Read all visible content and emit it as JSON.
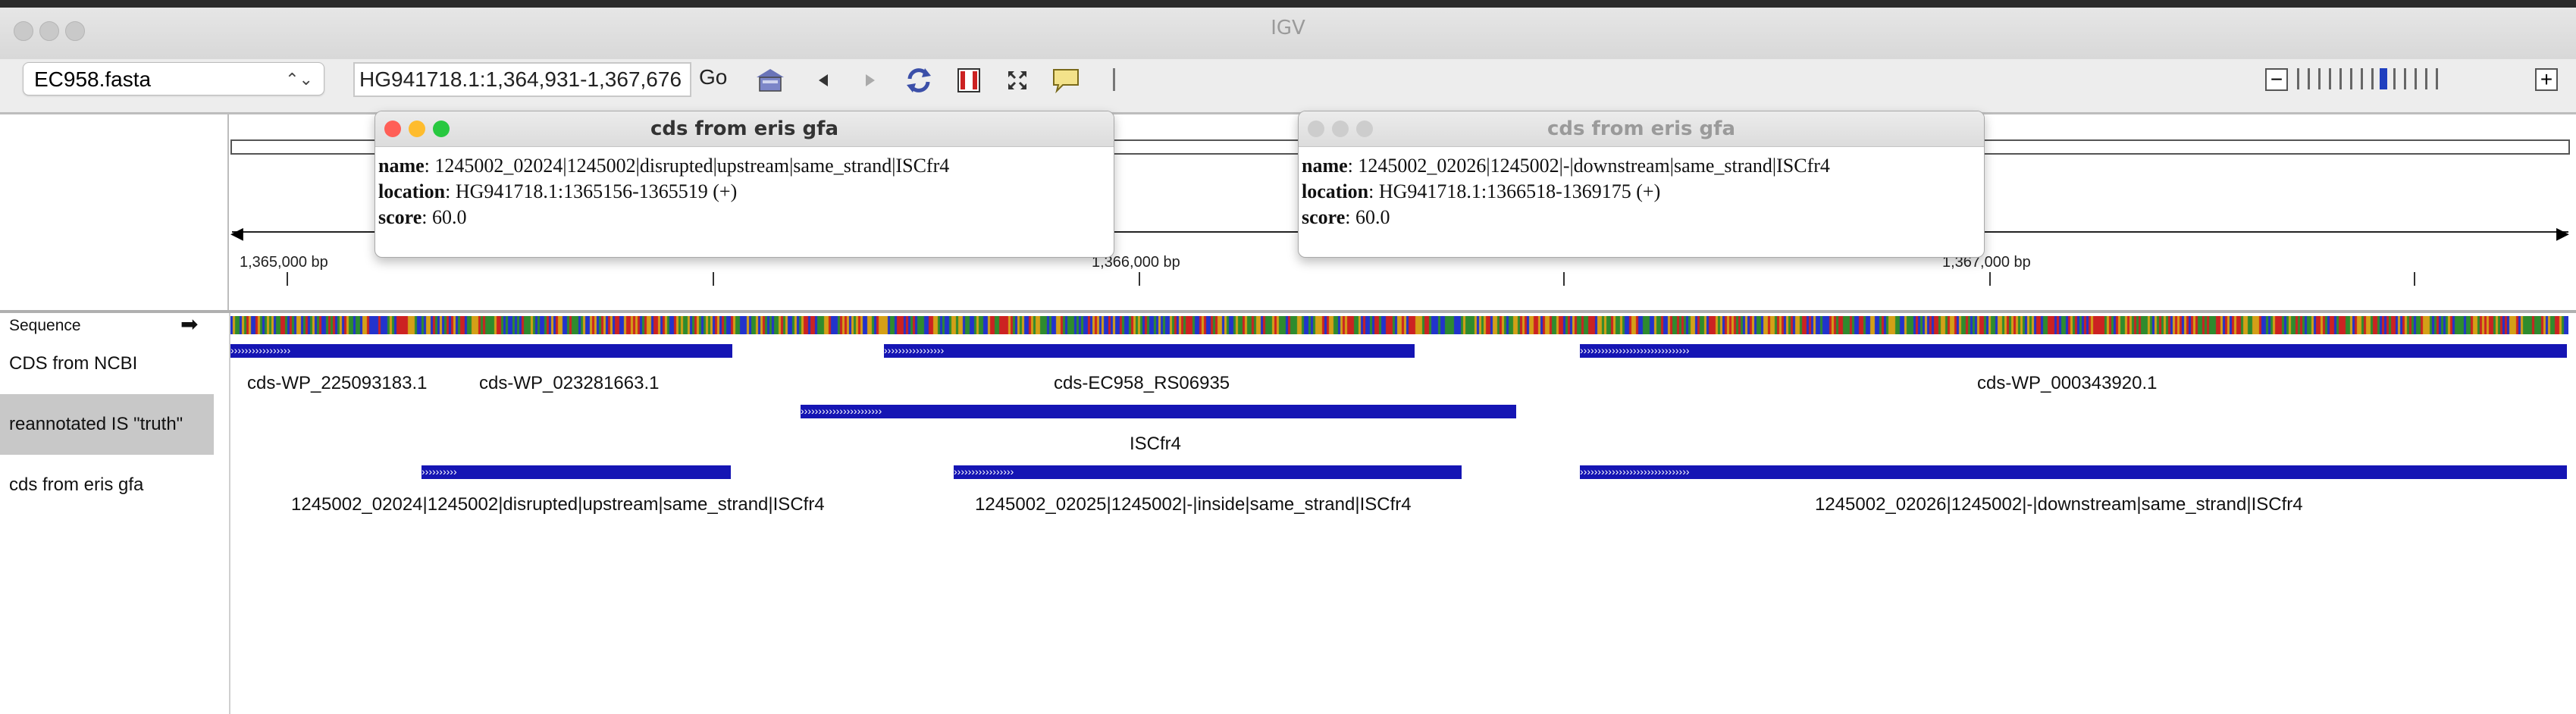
{
  "window": {
    "title": "IGV"
  },
  "toolbar": {
    "genome": "EC958.fasta",
    "locus": "HG941718.1:1,364,931-1,367,676",
    "go_label": "Go",
    "zoom_minus": "−",
    "zoom_plus": "+"
  },
  "ruler": {
    "ticks": [
      "1,365,000 bp",
      "1,366,000 bp",
      "1,367,000 bp"
    ]
  },
  "tracks": {
    "sequence": "Sequence",
    "ncbi": "CDS from NCBI",
    "truth": "reannotated IS \"truth\"",
    "eris": "cds from eris gfa"
  },
  "features": {
    "ncbi_labels": [
      "cds-WP_225093183.1",
      "cds-WP_023281663.1",
      "cds-EC958_RS06935",
      "cds-WP_000343920.1"
    ],
    "truth_labels": [
      "ISCfr4"
    ],
    "eris_labels": [
      "1245002_02024|1245002|disrupted|upstream|same_strand|ISCfr4",
      "1245002_02025|1245002|-|inside|same_strand|ISCfr4",
      "1245002_02026|1245002|-|downstream|same_strand|ISCfr4"
    ]
  },
  "popups": [
    {
      "title": "cds from eris gfa",
      "name_key": "name",
      "name": "1245002_02024|1245002|disrupted|upstream|same_strand|ISCfr4",
      "location_key": "location",
      "location": "HG941718.1:1365156-1365519 (+)",
      "score_key": "score",
      "score": "60.0"
    },
    {
      "title": "cds from eris gfa",
      "name_key": "name",
      "name": "1245002_02026|1245002|-|downstream|same_strand|ISCfr4",
      "location_key": "location",
      "location": "HG941718.1:1366518-1369175 (+)",
      "score_key": "score",
      "score": "60.0"
    }
  ],
  "colors": {
    "feature": "#1515b4",
    "close": "#ff5f57",
    "minimize": "#febc2e",
    "zoom": "#28c840",
    "zoom_active": "#1f3fbf"
  },
  "icons": [
    "home-icon",
    "back-icon",
    "forward-icon",
    "refresh-icon",
    "region-icon",
    "resize-icon",
    "popup-info-icon"
  ]
}
